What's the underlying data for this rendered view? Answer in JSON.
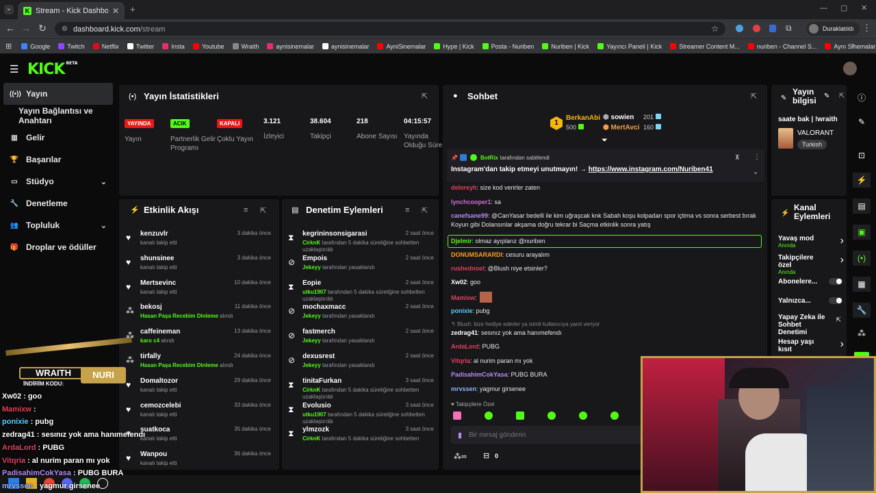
{
  "browser": {
    "tab_title": "Stream - Kick Dashboard",
    "url_host": "dashboard.kick.com",
    "url_path": "/stream",
    "profile_label": "Duraklatıldı",
    "bookmarks": [
      "Google",
      "Twitch",
      "Netflix",
      "Twitter",
      "Insta",
      "Youtube",
      "Wraith",
      "aynisinemalar",
      "aynisinemalar",
      "AyniSinemalar",
      "Hype | Kick",
      "Posta - Nuriben",
      "Nuriben | Kick",
      "Yayıncı Paneli | Kick",
      "Streamer Content M...",
      "nuriben - Channel S...",
      "Aynı Sinemalar - Ça..."
    ],
    "bookmark_colors": [
      "#4285f4",
      "#9146ff",
      "#e50914",
      "#ffffff",
      "#e1306c",
      "#ff0000",
      "#888888",
      "#e1306c",
      "#ffffff",
      "#ff0000",
      "#53fc18",
      "#53fc18",
      "#53fc18",
      "#53fc18",
      "#ff0000",
      "#ff0000",
      "#ff0000"
    ]
  },
  "header": {
    "logo": "KICK",
    "beta": "BETA"
  },
  "sidebar": {
    "items": [
      {
        "label": "Yayın",
        "icon": "radio-icon"
      },
      {
        "label": "Yayın Bağlantısı ve Anahtarı",
        "icon": ""
      },
      {
        "label": "Gelir",
        "icon": "chart-icon"
      },
      {
        "label": "Başarılar",
        "icon": "trophy-icon"
      },
      {
        "label": "Stüdyo",
        "icon": "studio-icon"
      },
      {
        "label": "Denetleme",
        "icon": "wrench-icon"
      },
      {
        "label": "Topluluk",
        "icon": "people-icon"
      },
      {
        "label": "Droplar ve ödüller",
        "icon": "gift-icon"
      }
    ]
  },
  "stats": {
    "title": "Yayın İstatistikleri",
    "items": [
      {
        "badge": "YAYINDA",
        "label": "Yayın"
      },
      {
        "badge": "ACIK",
        "label": "Partnerlik Gelir Programı"
      },
      {
        "badge": "KAPALI",
        "label": "Çoklu Yayın"
      },
      {
        "value": "3.121",
        "label": "İzleyici"
      },
      {
        "value": "38.604",
        "label": "Takipçi"
      },
      {
        "value": "218",
        "label": "Abone Sayısı"
      },
      {
        "value": "04:15:57",
        "label": "Yayında Olduğu Süre"
      }
    ]
  },
  "activity": {
    "title": "Etkinlik Akışı",
    "items": [
      {
        "name": "kenzuvlr",
        "sub": "kanalı takip etti",
        "time": "3 dakika önce",
        "type": "follow"
      },
      {
        "name": "shunsinee",
        "sub": "kanalı takip etti",
        "time": "3 dakika önce",
        "type": "follow"
      },
      {
        "name": "Mertsevinc",
        "sub": "kanalı takip etti",
        "time": "10 dakika önce",
        "type": "follow"
      },
      {
        "name": "bekosj",
        "reward": "Hasan Paşa Recebim Dinleme",
        "suffix": "alındı",
        "time": "11 dakika önce",
        "type": "reward"
      },
      {
        "name": "caffeineman",
        "reward": "karo c4",
        "suffix": "alındı",
        "time": "13 dakika önce",
        "type": "reward"
      },
      {
        "name": "tirfally",
        "reward": "Hasan Paşa Recebim Dinleme",
        "suffix": "alındı",
        "time": "24 dakika önce",
        "type": "reward"
      },
      {
        "name": "Domaltozor",
        "sub": "kanalı takip etti",
        "time": "29 dakika önce",
        "type": "follow"
      },
      {
        "name": "cemozcelebi",
        "sub": "kanalı takip etti",
        "time": "33 dakika önce",
        "type": "follow"
      },
      {
        "name": "suatkoca",
        "sub": "kanalı takip etti",
        "time": "35 dakika önce",
        "type": "follow"
      },
      {
        "name": "Wanpou",
        "sub": "kanalı takip etti",
        "time": "36 dakika önce",
        "type": "follow"
      }
    ]
  },
  "moderation": {
    "title": "Denetim Eylemleri",
    "items": [
      {
        "name": "kegrininsonsigarasi",
        "mod": "CirknK",
        "text": "tarafından 5 dakika süreliğine sohbetten uzaklaştırıldı",
        "time": "2 saat önce",
        "type": "timeout"
      },
      {
        "name": "Empois",
        "mod": "Jekeyy",
        "text": "tarafından yasaklandı",
        "time": "2 saat önce",
        "type": "ban"
      },
      {
        "name": "Eopie",
        "mod": "utku1907",
        "text": "tarafından 5 dakika süreliğine sohbetten uzaklaştırıldı",
        "time": "2 saat önce",
        "type": "timeout"
      },
      {
        "name": "mochaxmacc",
        "mod": "Jekeyy",
        "text": "tarafından yasaklandı",
        "time": "2 saat önce",
        "type": "ban"
      },
      {
        "name": "fastmerch",
        "mod": "Jekeyy",
        "text": "tarafından yasaklandı",
        "time": "2 saat önce",
        "type": "ban"
      },
      {
        "name": "dexusrest",
        "mod": "Jekeyy",
        "text": "tarafından yasaklandı",
        "time": "2 saat önce",
        "type": "ban"
      },
      {
        "name": "tinitaFurkan",
        "mod": "CirknK",
        "text": "tarafından 5 dakika süreliğine sohbetten uzaklaştırıldı",
        "time": "3 saat önce",
        "type": "timeout"
      },
      {
        "name": "Evolusio",
        "mod": "utku1907",
        "text": "tarafından 5 dakika süreliğine sohbetten uzaklaştırıldı",
        "time": "3 saat önce",
        "type": "timeout"
      },
      {
        "name": "ylmzozk",
        "mod": "CirknK",
        "text": "tarafından 5 dakika süreliğine sohbetten",
        "time": "3 saat önce",
        "type": "timeout"
      }
    ]
  },
  "chat": {
    "title": "Sohbet",
    "leaders": [
      {
        "rank": "1",
        "name": "BerkanAbi",
        "amount": "500"
      },
      {
        "name": "sowien",
        "amount": "201"
      },
      {
        "name": "MertAvci",
        "amount": "160"
      }
    ],
    "pinned": {
      "by": "BotRix",
      "by_suffix": "tarafından sabitlendi",
      "text": "Instagram'dan takip etmeyi unutmayın! →",
      "link": "https://www.instagram.com/Nuriben41"
    },
    "messages": [
      {
        "user": "deloreyh",
        "color": "#e0405b",
        "text": ": size kod verirler zaten"
      },
      {
        "user": "lynchcooper1",
        "color": "#d16bd6",
        "text": ": sa"
      },
      {
        "user": "canefsane99",
        "color": "#b58cf0",
        "text": ": @CanYasar bedelli ile kim uğraşcak knk Sabah koşu kolpadan spor içtima vs sonra serbest bırak Koyun gibi Dolansınlar akşama doğru tekrar bi Saçma etkinlik sonra yatış"
      },
      {
        "user": "Djelmir",
        "color": "#53fc18",
        "text": ": olmaz ayıplarız @nuriben"
      },
      {
        "user": "DONUMSARARDI",
        "color": "#ff9f1a",
        "text": ": cesuru arayalım"
      },
      {
        "user": "rushednoel",
        "color": "#e0405b",
        "text": ": @Blush niye etsinler?"
      },
      {
        "user": "Xw02",
        "color": "#ffffff",
        "text": ": goo"
      },
      {
        "user": "Mamixw",
        "color": "#e0405b",
        "text": ":"
      },
      {
        "user": "ponixie",
        "color": "#53d0ff",
        "text": ": pubg"
      },
      {
        "reply": "Blush: bize hediye ederler ya isimli kullanıcıya yanıt veriyor"
      },
      {
        "user": "zedrag41",
        "color": "#ffffff",
        "text": ": sesınız yok ama hanımefendı"
      },
      {
        "user": "ArdaLord",
        "color": "#e0405b",
        "text": ": PUBG"
      },
      {
        "user": "Vitqria",
        "color": "#e0405b",
        "text": ": al nurim paran mı yok"
      },
      {
        "user": "PadisahimCokYasa",
        "color": "#b58cf0",
        "text": ": PUBG BURA"
      },
      {
        "user": "mrvssen",
        "color": "#8fb3ff",
        "text": ": yagmur girsenee"
      }
    ],
    "followers_only": "Takipçilere Özel",
    "input_placeholder": "Bir mesaj gönderin",
    "points": "0"
  },
  "stream_info": {
    "title": "Yayın bilgisi",
    "stream_title": "saate bak | !wraith",
    "category": "VALORANT",
    "language": "Turkish"
  },
  "channel_actions": {
    "title": "Kanal Eylemleri",
    "items": [
      {
        "label": "Yavaş mod",
        "sub": "Anında",
        "control": "chevron"
      },
      {
        "label": "Takipçilere özel",
        "sub": "Anında",
        "control": "chevron"
      },
      {
        "label": "Abonelere...",
        "control": "toggle"
      },
      {
        "label": "Yalnızca...",
        "control": "toggle"
      },
      {
        "label": "Yapay Zeka ile Sohbet Denetimi",
        "control": "link"
      },
      {
        "label": "Hesap yaşı kısıt",
        "control": "chevron"
      }
    ]
  },
  "overlay": {
    "promo_brand": "WRAITH",
    "promo_code_label": "İNDİRİM KODU:",
    "promo_code": "NURI",
    "lines": [
      {
        "user": "Xw02",
        "color": "#ffffff",
        "text": " : goo"
      },
      {
        "user": "Mamixw",
        "color": "#e0405b",
        "text": " :"
      },
      {
        "user": "ponixie",
        "color": "#53d0ff",
        "text": " : pubg"
      },
      {
        "user": "zedrag41",
        "color": "#ffffff",
        "text": " : sesınız yok ama hanımefendı"
      },
      {
        "user": "ArdaLord",
        "color": "#e0405b",
        "text": " : PUBG"
      },
      {
        "user": "Vitqria",
        "color": "#e0405b",
        "text": " : al nurim paran mı yok"
      },
      {
        "user": "PadisahimCokYasa",
        "color": "#b58cf0",
        "text": " : PUBG BURA"
      },
      {
        "user": "mrvssen",
        "color": "#8fb3ff",
        "text": " : yagmur girsenee"
      }
    ]
  },
  "colors": {
    "accent": "#53fc18",
    "live": "#e91916",
    "panel": "#18181b"
  }
}
